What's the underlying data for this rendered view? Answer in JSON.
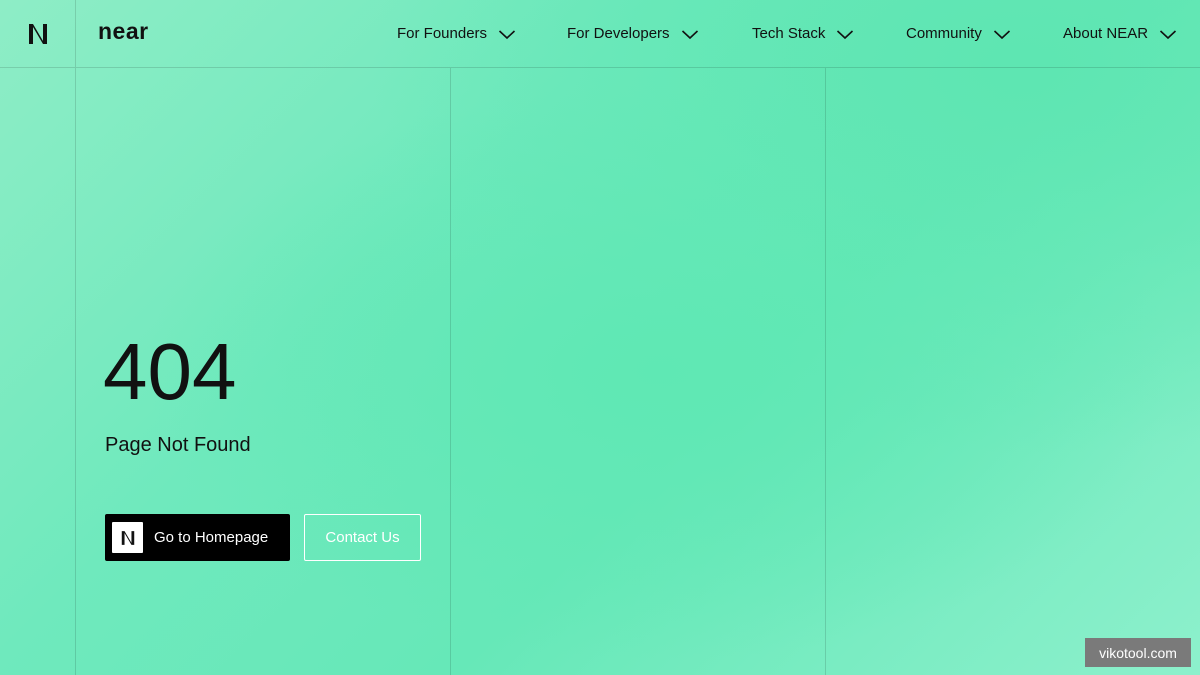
{
  "header": {
    "logo_icon": "near-n-logo-icon",
    "wordmark": "near",
    "nav": [
      {
        "label": "For Founders",
        "icon": "chevron-down-icon"
      },
      {
        "label": "For Developers",
        "icon": "chevron-down-icon"
      },
      {
        "label": "Tech Stack",
        "icon": "chevron-down-icon"
      },
      {
        "label": "Community",
        "icon": "chevron-down-icon"
      },
      {
        "label": "About NEAR",
        "icon": "chevron-down-icon"
      }
    ]
  },
  "main": {
    "error_code": "404",
    "message": "Page Not Found",
    "home_button": {
      "label": "Go to Homepage",
      "icon": "near-n-logo-icon"
    },
    "contact_button": {
      "label": "Contact Us"
    }
  },
  "watermark": "vikotool.com",
  "colors": {
    "background_accent": "#66e8b8",
    "primary_button": "#000000",
    "text": "#111111",
    "outline_button": "#ffffff"
  }
}
